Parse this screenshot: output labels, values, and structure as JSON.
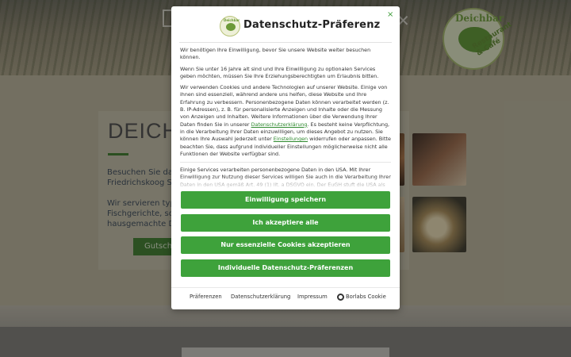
{
  "site": {
    "logo_name": "Deichbar",
    "logo_sub": "Restaurant & Café",
    "card_title": "DEICH",
    "card_text_lines": [
      "Besuchen Sie das R",
      "Friedrichskoog Spit",
      "",
      "Wir servieren typis",
      "Fischgerichte, sowi",
      "hausgemachte Des"
    ],
    "card_button": "Gutsch"
  },
  "modal": {
    "logo_text": "Deichbar",
    "title": "Datenschutz-Präferenz",
    "close_symbol": "×",
    "paragraphs": {
      "p1": "Wir benötigen Ihre Einwilligung, bevor Sie unsere Website weiter besuchen können.",
      "p2": "Wenn Sie unter 16 Jahre alt sind und Ihre Einwilligung zu optionalen Services geben möchten, müssen Sie Ihre Erziehungsberechtigten um Erlaubnis bitten.",
      "p3_a": "Wir verwenden Cookies und andere Technologien auf unserer Website. Einige von ihnen sind essenziell, während andere uns helfen, diese Website und Ihre Erfahrung zu verbessern. Personenbezogene Daten können verarbeitet werden (z. B. IP-Adressen), z. B. für personalisierte Anzeigen und Inhalte oder die Messung von Anzeigen und Inhalten. Weitere Informationen über die Verwendung Ihrer Daten finden Sie in unserer",
      "p3_link1": "Datenschutzerklärung",
      "p3_b": ". Es besteht keine Verpflichtung, in die Verarbeitung Ihrer Daten einzuwilligen, um dieses Angebot zu nutzen. Sie können Ihre Auswahl jederzeit unter",
      "p3_link2": "Einstellungen",
      "p3_c": "widerrufen oder anpassen. Bitte beachten Sie, dass aufgrund individueller Einstellungen möglicherweise nicht alle Funktionen der Website verfügbar sind.",
      "p4": "Einige Services verarbeiten personenbezogene Daten in den USA. Mit Ihrer Einwilligung zur Nutzung dieser Services willigen Sie auch in die Verarbeitung Ihrer Daten in den USA gemäß Art. 49 (1) lit. a DSGVO ein. Der EuGH stuft die USA als ein Land mit unzureichendem Datenschutz nach EU-Standards ein. Es besteht beispielsweise die Gefahr, dass US-Behörden personenbezogene Daten in"
    },
    "buttons": {
      "accept_all": "Einwilligung speichern",
      "accept": "Ich akzeptiere alle",
      "essential": "Nur essenzielle Cookies akzeptieren",
      "individual": "Individuelle Datenschutz-Präferenzen"
    },
    "footer": {
      "preferences": "Präferenzen",
      "privacy": "Datenschutzerklärung",
      "imprint": "Impressum",
      "borlabs": "Borlabs Cookie"
    },
    "accent_color": "#3ea23b"
  }
}
